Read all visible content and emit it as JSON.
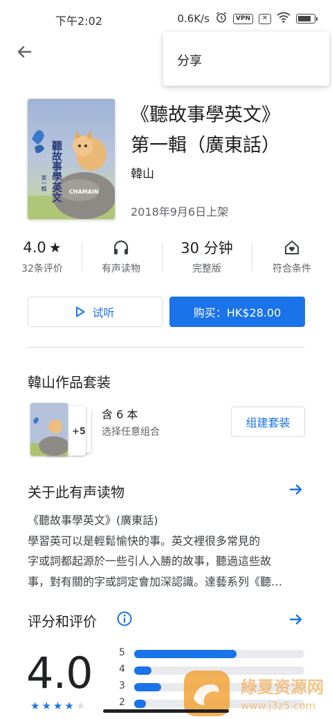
{
  "status": {
    "time": "下午2:02",
    "net_speed": "0.6K/s",
    "vpn_label": "VPN",
    "battery_level": 0.75
  },
  "menu": {
    "share_label": "分享"
  },
  "book": {
    "title_line1": "《聽故事學英文》",
    "title_line2": "第一輯（廣東話）",
    "author": "韓山",
    "release_date": "2018年9月6日上架",
    "cover_text": "聽故事學英文",
    "cover_sub": "第一輯",
    "cover_brand": "CHAMAIN"
  },
  "stats": {
    "rating_value": "4.0",
    "rating_count": "32条评价",
    "audio_label": "有声读物",
    "duration_value": "30 分钟",
    "duration_label": "完整版",
    "eligible_label": "符合条件"
  },
  "actions": {
    "sample_label": "试听",
    "buy_label": "购买：HK$28.00"
  },
  "bundle": {
    "section_title": "韓山作品套装",
    "extra_count": "+5",
    "count_text": "含 6 本",
    "subtitle": "选择任意组合",
    "build_button": "组建套装"
  },
  "about": {
    "section_title": "关于此有声读物",
    "lines": [
      "《聽故事學英文》(廣東話)",
      "學習英可以是輕鬆愉快的事。英文裡很多常見的",
      "字或詞都起源於一些引人入勝的故事，聽過這些故",
      "事，對有關的字或詞定會加深認識。達藝系列《聽…"
    ]
  },
  "ratings": {
    "section_title": "评分和评价",
    "average": "4.0",
    "stars_filled": 4,
    "bars": [
      {
        "label": "5",
        "fraction": 0.6
      },
      {
        "label": "4",
        "fraction": 0.1
      },
      {
        "label": "3",
        "fraction": 0.16
      },
      {
        "label": "2",
        "fraction": 0.07
      }
    ]
  },
  "watermark": {
    "title": "綠夏资源网",
    "url": "www.j3z5.com"
  },
  "colors": {
    "accent": "#1a73e8",
    "text_primary": "#202124",
    "text_secondary": "#5f6368",
    "divider": "#dadce0"
  }
}
